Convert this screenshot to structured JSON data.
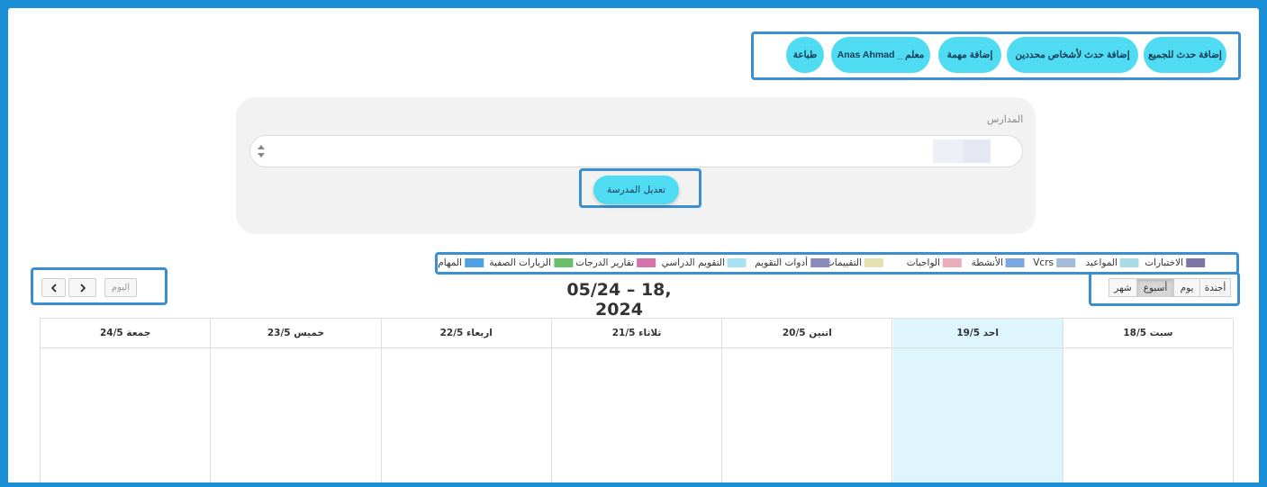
{
  "actions": {
    "add_all": "إضافة حدث للجميع",
    "add_specific": "إضافة حدث لأشخاص محددين",
    "add_task": "إضافة مهمة",
    "teacher": "Anas Ahmad _ معلم",
    "print": "طباعة"
  },
  "schools": {
    "label": "المدارس",
    "edit_button": "تعديل المدرسة"
  },
  "legend": [
    {
      "label": "الاختبارات",
      "color": "#7b76a6"
    },
    {
      "label": "المواعيد",
      "color": "#a9dbe6"
    },
    {
      "label": "Vcrs",
      "color": "#a3bcd9"
    },
    {
      "label": "الأنشطة",
      "color": "#79a9e0"
    },
    {
      "label": "الواجبات",
      "color": "#e8aeb9"
    },
    {
      "label": "التقييمات",
      "color": "#e4e2b0"
    },
    {
      "label": "أدوات التقويم",
      "color": "#8b88bd"
    },
    {
      "label": "التقويم الدراسي",
      "color": "#a8e2f3"
    },
    {
      "label": "تقارير الدرجات",
      "color": "#d472aa"
    },
    {
      "label": "الزيارات الصفية",
      "color": "#6abf6a"
    },
    {
      "label": "المهام",
      "color": "#4ba1e4"
    }
  ],
  "nav": {
    "today": "اليوم",
    "prev": "<",
    "next": ">"
  },
  "title": "05/24 – 18, 2024",
  "views": {
    "agenda": "أجندة",
    "day": "يوم",
    "week": "أسبوع",
    "month": "شهر",
    "active": "week"
  },
  "days": [
    {
      "label": "سبت 18/5",
      "today": false
    },
    {
      "label": "احد 19/5",
      "today": true
    },
    {
      "label": "اتنين 20/5",
      "today": false
    },
    {
      "label": "ثلاثاء 21/5",
      "today": false
    },
    {
      "label": "اربعاء 22/5",
      "today": false
    },
    {
      "label": "خميس 23/5",
      "today": false
    },
    {
      "label": "جمعة 24/5",
      "today": false
    }
  ],
  "colors": {
    "accent": "#4fdcf2",
    "highlight_border": "#3b8fd0",
    "today_bg": "#def5fb",
    "frame": "#1a8fd6"
  }
}
